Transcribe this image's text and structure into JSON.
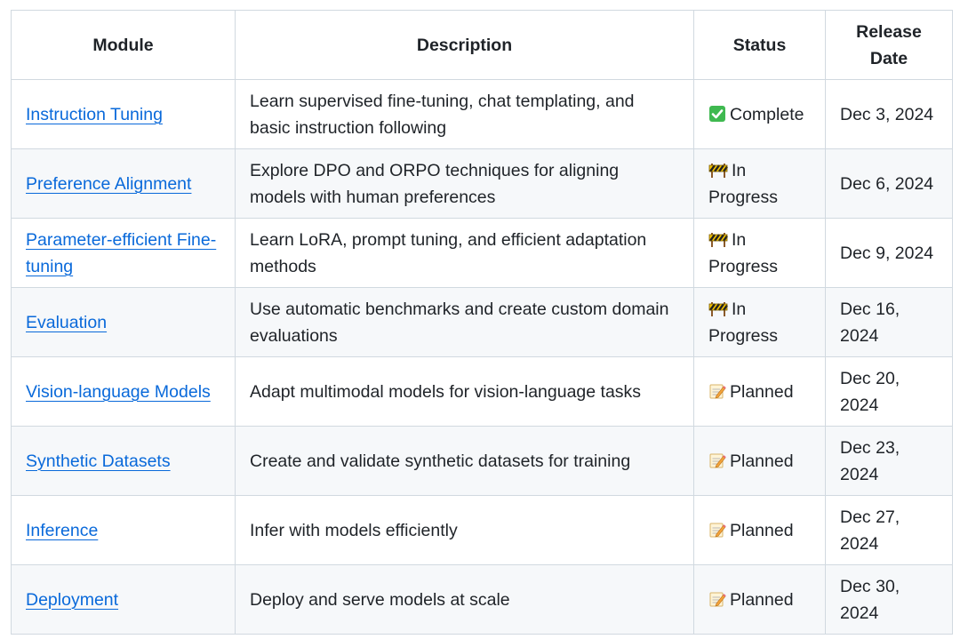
{
  "headers": {
    "module": "Module",
    "description": "Description",
    "status": "Status",
    "release_date": "Release Date"
  },
  "rows": [
    {
      "module": "Instruction Tuning",
      "description": "Learn supervised fine-tuning, chat templating, and basic instruction following",
      "status_icon": "check-mark-icon",
      "status": "Complete",
      "date": "Dec 3, 2024"
    },
    {
      "module": "Preference Alignment",
      "description": "Explore DPO and ORPO techniques for aligning models with human preferences",
      "status_icon": "construction-icon",
      "status": "In Progress",
      "date": "Dec 6, 2024"
    },
    {
      "module": "Parameter-efficient Fine-tuning",
      "description": "Learn LoRA, prompt tuning, and efficient adaptation methods",
      "status_icon": "construction-icon",
      "status": "In Progress",
      "date": "Dec 9, 2024"
    },
    {
      "module": "Evaluation",
      "description": "Use automatic benchmarks and create custom domain evaluations",
      "status_icon": "construction-icon",
      "status": "In Progress",
      "date": "Dec 16, 2024"
    },
    {
      "module": "Vision-language Models",
      "description": "Adapt multimodal models for vision-language tasks",
      "status_icon": "memo-icon",
      "status": "Planned",
      "date": "Dec 20, 2024"
    },
    {
      "module": "Synthetic Datasets",
      "description": "Create and validate synthetic datasets for training",
      "status_icon": "memo-icon",
      "status": "Planned",
      "date": "Dec 23, 2024"
    },
    {
      "module": "Inference",
      "description": "Infer with models efficiently",
      "status_icon": "memo-icon",
      "status": "Planned",
      "date": "Dec 27, 2024"
    },
    {
      "module": "Deployment",
      "description": "Deploy and serve models at scale",
      "status_icon": "memo-icon",
      "status": "Planned",
      "date": "Dec 30, 2024"
    }
  ],
  "colors": {
    "link": "#0969da",
    "border": "#d1d9e0",
    "stripe": "#f6f8fa",
    "check_green": "#3fb950"
  }
}
